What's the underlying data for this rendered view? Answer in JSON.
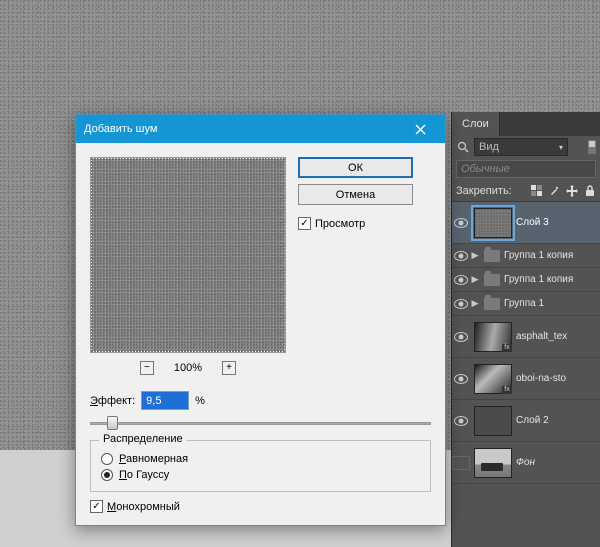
{
  "dialog": {
    "title": "Добавить шум",
    "ok": "ОК",
    "cancel": "Отмена",
    "preview_label": "Просмотр",
    "preview_checked": true,
    "zoom": "100%",
    "amount_label": "Эффект:",
    "amount_underline": "Э",
    "amount_value": "9,5",
    "amount_unit": "%",
    "slider_position_pct": 5,
    "distribution_legend": "Распределение",
    "uniform_label": "Равномерная",
    "uniform_underline": "Р",
    "gaussian_label": "По Гауссу",
    "gaussian_underline": "П",
    "selected_distribution": "gaussian",
    "monochrome_label": "Монохромный",
    "monochrome_underline": "М",
    "monochrome_checked": true
  },
  "layers": {
    "tab": "Слои",
    "kind": "Вид",
    "blend": "Обычные",
    "lock_label": "Закрепить:",
    "lock_icons": [
      "pixels",
      "brush",
      "move",
      "lock"
    ],
    "items": [
      {
        "type": "layer",
        "name": "Слой 3",
        "selected": true,
        "visible": true,
        "thumb": "noise"
      },
      {
        "type": "group",
        "name": "Группа 1 копия",
        "visible": true
      },
      {
        "type": "group",
        "name": "Группа 1 копия",
        "visible": true
      },
      {
        "type": "group",
        "name": "Группа 1",
        "visible": true
      },
      {
        "type": "layer",
        "name": "asphalt_tex",
        "visible": true,
        "thumb": "tex1",
        "fx": true
      },
      {
        "type": "layer",
        "name": "oboi-na-sto",
        "visible": true,
        "thumb": "tex2",
        "fx": true
      },
      {
        "type": "layer",
        "name": "Слой 2",
        "visible": true,
        "thumb": "flat"
      },
      {
        "type": "layer",
        "name": "Фон",
        "visible": false,
        "thumb": "photo"
      }
    ]
  }
}
